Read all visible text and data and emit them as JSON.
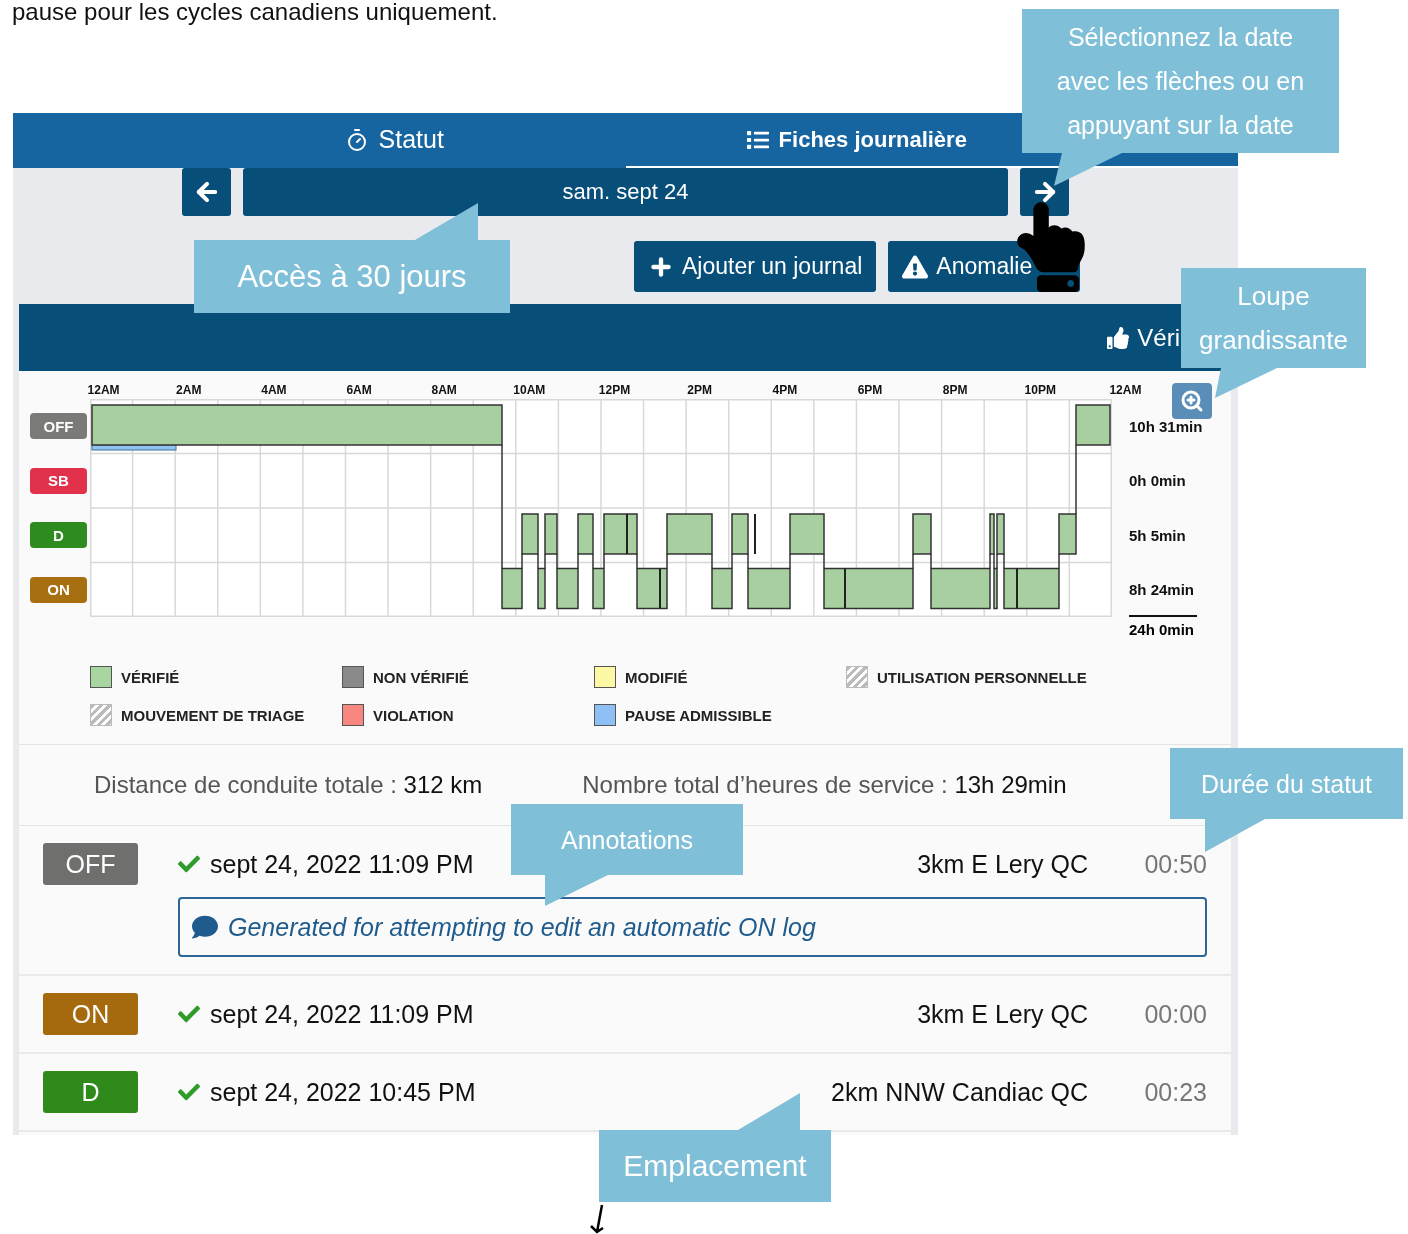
{
  "intro_text": "pause pour les cycles canadiens uniquement.",
  "tabs": [
    {
      "label": "Statut",
      "selected": false
    },
    {
      "label": "Fiches journalière",
      "selected": true
    }
  ],
  "date_nav": {
    "date": "sam. sept 24"
  },
  "actions": [
    {
      "label": "Ajouter un journal",
      "kind": "add"
    },
    {
      "label": "Anomalie",
      "kind": "warning"
    }
  ],
  "header_bar": {
    "label": "Véri"
  },
  "chart": {
    "hours": [
      "12AM",
      "2AM",
      "4AM",
      "6AM",
      "8AM",
      "10AM",
      "12PM",
      "2PM",
      "4PM",
      "6PM",
      "8PM",
      "10PM",
      "12AM"
    ],
    "status_rows": [
      {
        "label": "OFF",
        "kind": "off",
        "total": "10h 31min"
      },
      {
        "label": "SB",
        "kind": "sb",
        "total": "0h 0min"
      },
      {
        "label": "D",
        "kind": "d",
        "total": "5h 5min"
      },
      {
        "label": "ON",
        "kind": "on",
        "total": "8h 24min"
      }
    ],
    "total": "24h 0min"
  },
  "legend": [
    {
      "label": "VÉRIFIÉ",
      "kind": "solid",
      "color": "#a8d5a0"
    },
    {
      "label": "NON VÉRIFIÉ",
      "kind": "solid",
      "color": "#8a8a8a"
    },
    {
      "label": "MODIFIÉ",
      "kind": "solid",
      "color": "#fdf8a6"
    },
    {
      "label": "UTILISATION PERSONNELLE",
      "kind": "hatched"
    },
    {
      "label": "MOUVEMENT DE TRIAGE",
      "kind": "hatched"
    },
    {
      "label": "VIOLATION",
      "kind": "solid",
      "color": "#f7877f"
    },
    {
      "label": "PAUSE ADMISSIBLE",
      "kind": "solid",
      "color": "#8fc0f5"
    }
  ],
  "summary": [
    {
      "label": "Distance de conduite totale :",
      "value": "312 km"
    },
    {
      "label": "Nombre total d’heures de service :",
      "value": "13h 29min"
    }
  ],
  "logs": [
    {
      "status": "OFF",
      "kind": "off",
      "verified": true,
      "datetime": "sept 24, 2022 11:09 PM",
      "location": "3km E Lery QC",
      "duration": "00:50",
      "annotation": "Generated for attempting to edit an automatic ON log"
    },
    {
      "status": "ON",
      "kind": "on",
      "verified": true,
      "datetime": "sept 24, 2022 11:09 PM",
      "location": "3km E Lery QC",
      "duration": "00:00"
    },
    {
      "status": "D",
      "kind": "d",
      "verified": true,
      "datetime": "sept 24, 2022 10:45 PM",
      "location": "2km NNW Candiac QC",
      "duration": "00:23"
    }
  ],
  "callouts": [
    {
      "text": "Sélectionnez la date avec les flèches ou en appuyant sur la date"
    },
    {
      "text": "Accès à 30 jours"
    },
    {
      "text": "Loupe grandissante"
    },
    {
      "text": "Durée du statut"
    },
    {
      "text": "Annotations"
    },
    {
      "text": "Emplacement"
    }
  ]
}
